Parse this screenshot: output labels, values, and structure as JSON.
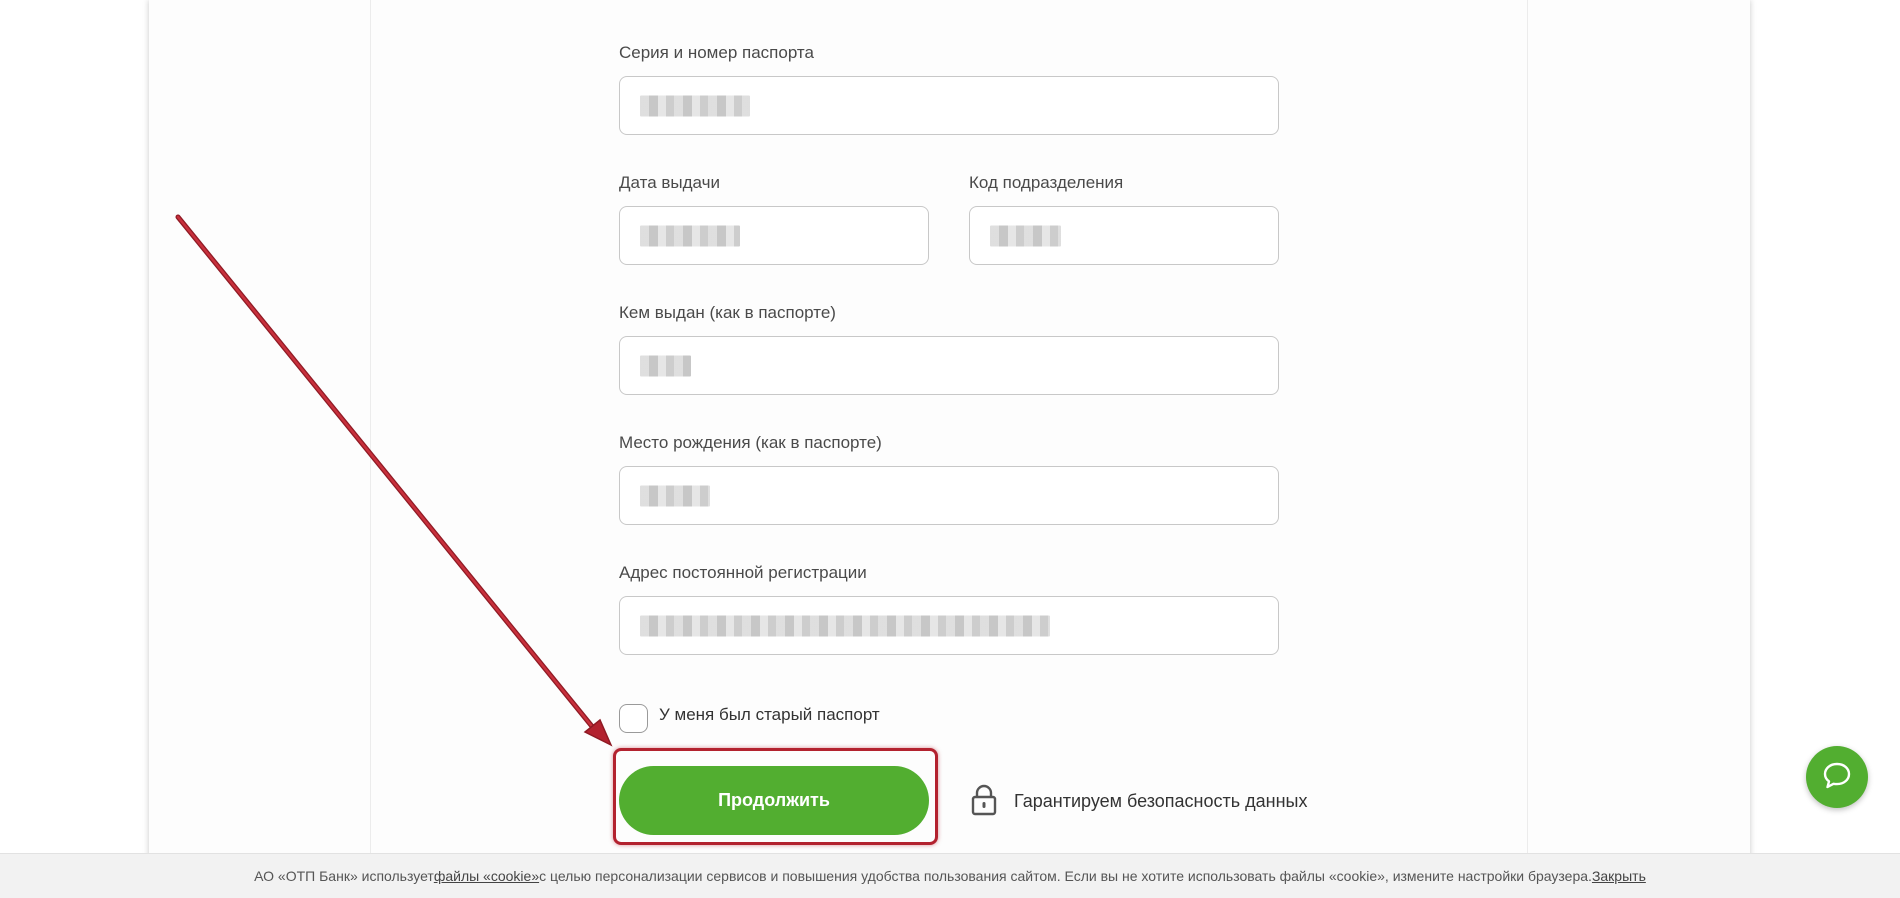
{
  "form": {
    "passport_label": "Серия и номер паспорта",
    "issue_date_label": "Дата выдачи",
    "dept_code_label": "Код подразделения",
    "issued_by_label": "Кем выдан (как в паспорте)",
    "birth_place_label": "Место рождения (как в паспорте)",
    "address_label": "Адрес постоянной регистрации",
    "old_passport_label": "У меня был старый паспорт",
    "old_passport_checked": false,
    "continue_label": "Продолжить",
    "security_text": "Гарантируем безопасность данных"
  },
  "cookie": {
    "text_before": "АО «ОТП Банк» использует ",
    "link_text": "файлы «cookie»",
    "text_after": " с целью персонализации сервисов и повышения удобства пользования сайтом. Если вы не хотите использовать файлы «cookie», измените настройки браузера. ",
    "close_label": "Закрыть"
  },
  "colors": {
    "accent_green": "#52ae30",
    "annotation_red": "#b3222f"
  },
  "icons": {
    "lock": "lock-icon",
    "chat": "chat-icon"
  }
}
